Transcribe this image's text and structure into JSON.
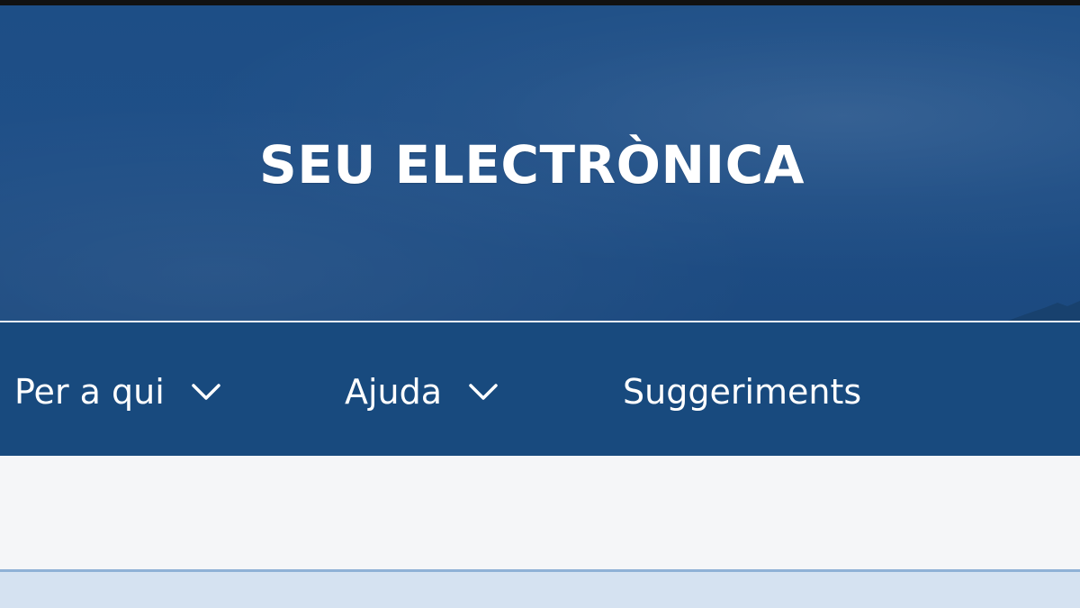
{
  "header": {
    "title": "SEU ELECTRÒNICA"
  },
  "nav": {
    "items": [
      {
        "label": "Per a qui",
        "icon": "chevron-down-icon"
      },
      {
        "label": "Ajuda",
        "icon": "chevron-down-icon"
      },
      {
        "label": "Suggeriments"
      }
    ]
  },
  "colors": {
    "hero_background": "#1d4e86",
    "nav_background": "#184a7e",
    "content_background": "#f5f6f8",
    "bottom_band": "#d5e2f1",
    "text": "#ffffff"
  }
}
